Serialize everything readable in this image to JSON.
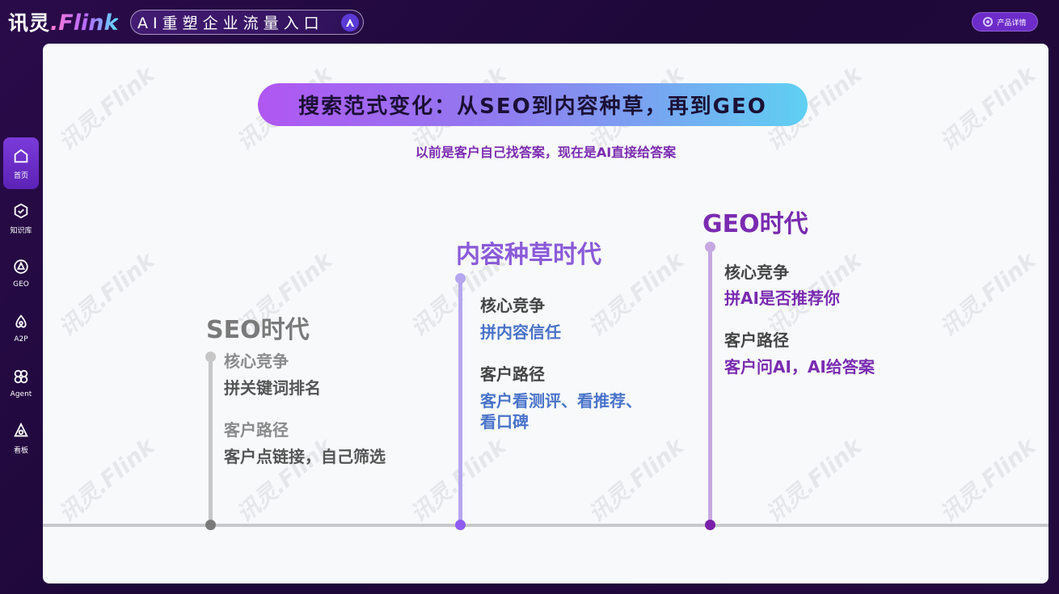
{
  "brand": {
    "name_cn": "讯灵",
    "name_en": ".Flink"
  },
  "header": {
    "slogan": "AI重塑企业流量入口",
    "detail_button": "产品详情"
  },
  "sidebar": {
    "items": [
      {
        "label": "首页",
        "icon": "home-icon",
        "active": true
      },
      {
        "label": "知识库",
        "icon": "knowledge-icon",
        "active": false
      },
      {
        "label": "GEO",
        "icon": "geo-icon",
        "active": false
      },
      {
        "label": "A2P",
        "icon": "a2p-icon",
        "active": false
      },
      {
        "label": "Agent",
        "icon": "agent-icon",
        "active": false
      },
      {
        "label": "看板",
        "icon": "dashboard-icon",
        "active": false
      }
    ]
  },
  "watermark": "讯灵.Flink",
  "slide": {
    "title": "搜索范式变化：从SEO到内容种草，再到GEO",
    "subtitle": "以前是客户自己找答案，现在是AI直接给答案",
    "eras": [
      {
        "name": "SEO时代",
        "competition_label": "核心竞争",
        "competition_value": "拼关键词排名",
        "path_label": "客户路径",
        "path_value": "客户点链接，自己筛选",
        "color": "#7a7a7a"
      },
      {
        "name": "内容种草时代",
        "competition_label": "核心竞争",
        "competition_value": "拼内容信任",
        "path_label": "客户路径",
        "path_value_lines": [
          "客户看测评、看推荐、",
          "看口碑"
        ],
        "color": "#8b5bd9"
      },
      {
        "name": "GEO时代",
        "competition_label": "核心竞争",
        "competition_value": "拼AI是否推荐你",
        "path_label": "客户路径",
        "path_value": "客户问AI，AI给答案",
        "color": "#7a2bb0"
      }
    ]
  },
  "colors": {
    "seo_stem": "#c6c6c6",
    "seo_dot": "#7a7a7a",
    "content_stem": "#b5a6f0",
    "content_dot": "#8e5cf0",
    "geo_stem": "#c7a8e0",
    "geo_dot": "#7a1fa8",
    "content_value": "#4a73c9",
    "geo_value": "#7a2bb0"
  }
}
